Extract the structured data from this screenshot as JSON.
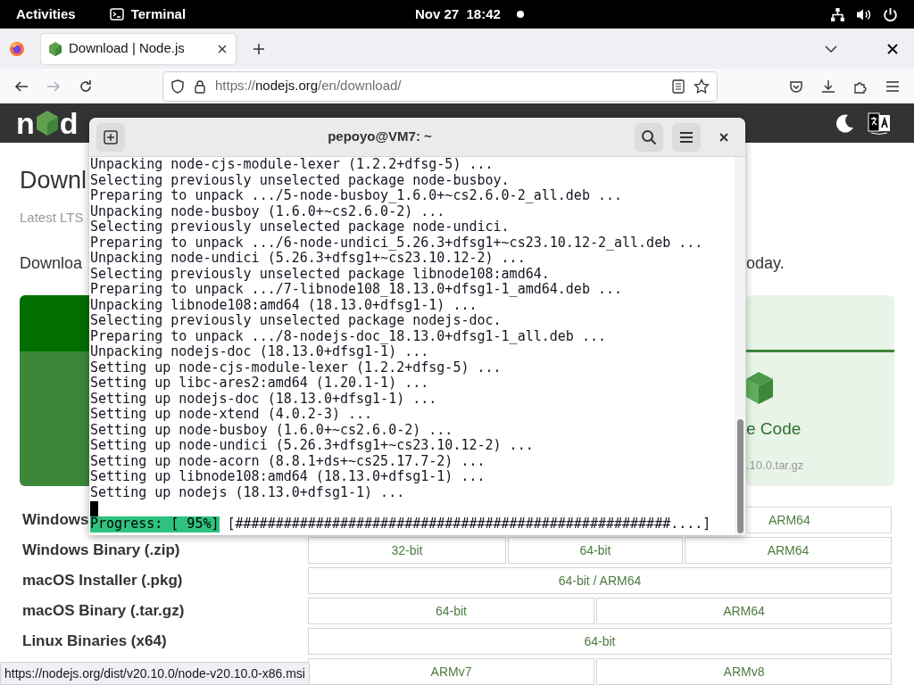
{
  "top_bar": {
    "activities": "Activities",
    "app": "Terminal",
    "clock": "Nov 27  18:42"
  },
  "browser": {
    "tabs": [
      {
        "title": "Download | Node.js",
        "selected": true
      }
    ],
    "nav_buttons": [
      {
        "kind": "back",
        "disabled": false
      },
      {
        "kind": "forward",
        "disabled": true
      },
      {
        "kind": "reload",
        "disabled": false
      }
    ],
    "url": {
      "scheme": "https://",
      "domain": "nodejs.org",
      "path": "/en/download/"
    },
    "status_link": "https://nodejs.org/dist/v20.10.0/node-v20.10.0-x86.msi"
  },
  "page": {
    "logo": {
      "left": "n",
      "right": "d"
    },
    "heading": "Downl",
    "subtitle": "Latest LTS",
    "intro_start": "Downloa",
    "intro_end": "oday.",
    "source_card": {
      "label": "e Code",
      "file": ".10.0.tar.gz"
    },
    "downloads": [
      {
        "label": "Windows",
        "kind": "thirds",
        "cells": [
          "ARM64"
        ]
      },
      {
        "label": "Windows Binary (.zip)",
        "kind": "thirds",
        "cells": [
          "32-bit",
          "64-bit",
          "ARM64"
        ]
      },
      {
        "label": "macOS Installer (.pkg)",
        "kind": "full",
        "cells": [
          "64-bit / ARM64"
        ]
      },
      {
        "label": "macOS Binary (.tar.gz)",
        "kind": "halves",
        "cells": [
          "64-bit",
          "ARM64"
        ]
      },
      {
        "label": "Linux Binaries (x64)",
        "kind": "full",
        "cells": [
          "64-bit"
        ]
      },
      {
        "kind": "halves",
        "cells": [
          "ARMv7",
          "ARMv8"
        ]
      }
    ]
  },
  "terminal": {
    "title": "pepoyo@VM7: ~",
    "lines": [
      "Unpacking node-cjs-module-lexer (1.2.2+dfsg-5) ...",
      "Selecting previously unselected package node-busboy.",
      "Preparing to unpack .../5-node-busboy_1.6.0+~cs2.6.0-2_all.deb ...",
      "Unpacking node-busboy (1.6.0+~cs2.6.0-2) ...",
      "Selecting previously unselected package node-undici.",
      "Preparing to unpack .../6-node-undici_5.26.3+dfsg1+~cs23.10.12-2_all.deb ...",
      "Unpacking node-undici (5.26.3+dfsg1+~cs23.10.12-2) ...",
      "Selecting previously unselected package libnode108:amd64.",
      "Preparing to unpack .../7-libnode108_18.13.0+dfsg1-1_amd64.deb ...",
      "Unpacking libnode108:amd64 (18.13.0+dfsg1-1) ...",
      "Selecting previously unselected package nodejs-doc.",
      "Preparing to unpack .../8-nodejs-doc_18.13.0+dfsg1-1_all.deb ...",
      "Unpacking nodejs-doc (18.13.0+dfsg1-1) ...",
      "Setting up node-cjs-module-lexer (1.2.2+dfsg-5) ...",
      "Setting up libc-ares2:amd64 (1.20.1-1) ...",
      "Setting up nodejs-doc (18.13.0+dfsg1-1) ...",
      "Setting up node-xtend (4.0.2-3) ...",
      "Setting up node-busboy (1.6.0+~cs2.6.0-2) ...",
      "Setting up node-undici (5.26.3+dfsg1+~cs23.10.12-2) ...",
      "Setting up node-acorn (8.8.1+ds+~cs25.17.7-2) ...",
      "Setting up libnode108:amd64 (18.13.0+dfsg1-1) ...",
      "Setting up nodejs (18.13.0+dfsg1-1) ..."
    ],
    "progress_label": "Progress: [ 95%]",
    "progress_bar": "[######################################################....]"
  }
}
